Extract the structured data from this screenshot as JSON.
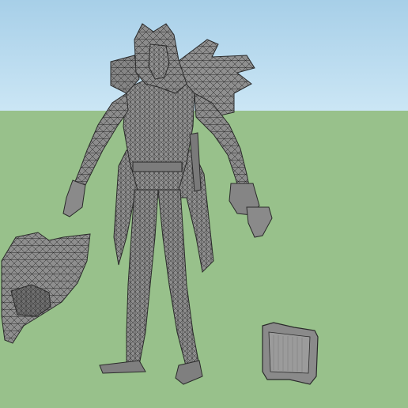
{
  "viewport": {
    "sky_color_top": "#a7cfe8",
    "sky_color_bottom": "#cbe6f5",
    "ground_color": "#98c18b",
    "mesh_fill": "#8f8f8f",
    "mesh_fill_dark": "#6e6e6e",
    "wire_color": "#2a2a2a",
    "objects": [
      {
        "name": "character-model"
      },
      {
        "name": "beast-head-helmet"
      },
      {
        "name": "banner-shield"
      }
    ]
  }
}
